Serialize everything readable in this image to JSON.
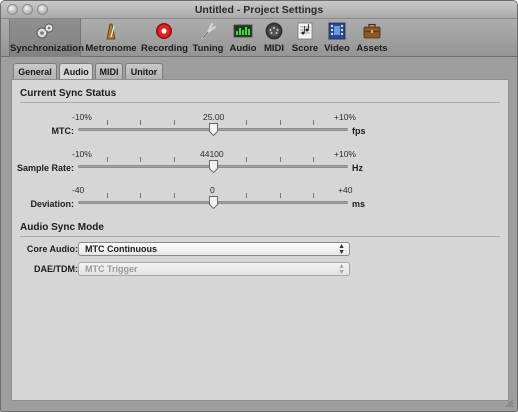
{
  "window": {
    "title": "Untitled - Project Settings"
  },
  "toolbar": {
    "items": [
      {
        "label": "Synchronization",
        "icon": "synchronization-icon",
        "selected": true
      },
      {
        "label": "Metronome",
        "icon": "metronome-icon"
      },
      {
        "label": "Recording",
        "icon": "recording-icon"
      },
      {
        "label": "Tuning",
        "icon": "tuning-fork-icon"
      },
      {
        "label": "Audio",
        "icon": "audio-icon"
      },
      {
        "label": "MIDI",
        "icon": "midi-icon"
      },
      {
        "label": "Score",
        "icon": "score-icon"
      },
      {
        "label": "Video",
        "icon": "video-icon"
      },
      {
        "label": "Assets",
        "icon": "assets-icon"
      }
    ]
  },
  "tabs": [
    {
      "label": "General"
    },
    {
      "label": "Audio",
      "selected": true
    },
    {
      "label": "MIDI"
    },
    {
      "label": "Unitor"
    }
  ],
  "sync_status": {
    "title": "Current Sync Status",
    "mtc": {
      "label": "MTC:",
      "min": "-10%",
      "value": "25.00",
      "max": "+10%",
      "unit": "fps"
    },
    "sample_rate": {
      "label": "Sample Rate:",
      "min": "-10%",
      "value": "44100",
      "max": "+10%",
      "unit": "Hz"
    },
    "deviation": {
      "label": "Deviation:",
      "min": "-40",
      "value": "0",
      "max": "+40",
      "unit": "ms"
    }
  },
  "audio_sync_mode": {
    "title": "Audio Sync Mode",
    "core_audio": {
      "label": "Core Audio:",
      "value": "MTC Continuous"
    },
    "dae_tdm": {
      "label": "DAE/TDM:",
      "value": "MTC Trigger",
      "disabled": true
    }
  },
  "colors": {
    "panel": "#d6d6d6",
    "toolbar": "#9e9e9e",
    "recording_red": "#e0202a"
  }
}
